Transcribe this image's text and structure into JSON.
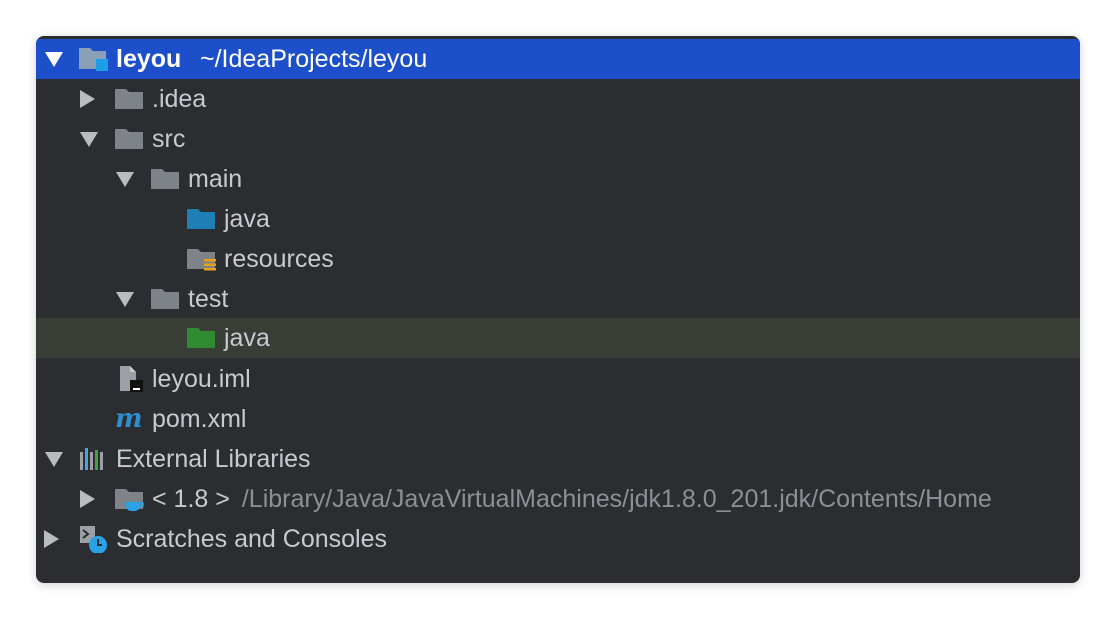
{
  "project": {
    "name": "leyou",
    "path": "~/IdeaProjects/leyou"
  },
  "tree": {
    "idea": ".idea",
    "src": "src",
    "main": "main",
    "main_java": "java",
    "resources": "resources",
    "test": "test",
    "test_java": "java",
    "iml": "leyou.iml",
    "pom": "pom.xml",
    "external_libraries": "External Libraries",
    "jdk_label": "< 1.8 >",
    "jdk_path": "/Library/Java/JavaVirtualMachines/jdk1.8.0_201.jdk/Contents/Home",
    "scratches": "Scratches and Consoles"
  },
  "icons": {
    "project_root": "project-folder-icon",
    "folder": "folder-icon",
    "source_root": "source-folder-icon",
    "resources_root": "resources-folder-icon",
    "test_root": "test-folder-icon",
    "module_file": "module-file-icon",
    "maven": "maven-icon",
    "libraries": "libraries-icon",
    "jdk": "jdk-icon",
    "scratches": "scratches-icon"
  },
  "colors": {
    "panel_bg": "#2b2d30",
    "selection": "#1e4fca",
    "hover_row": "#383d36",
    "folder_gray": "#7d8389",
    "source_blue": "#1e7fb4",
    "test_green": "#2f8b2f",
    "maven_blue": "#2e8fcf"
  }
}
